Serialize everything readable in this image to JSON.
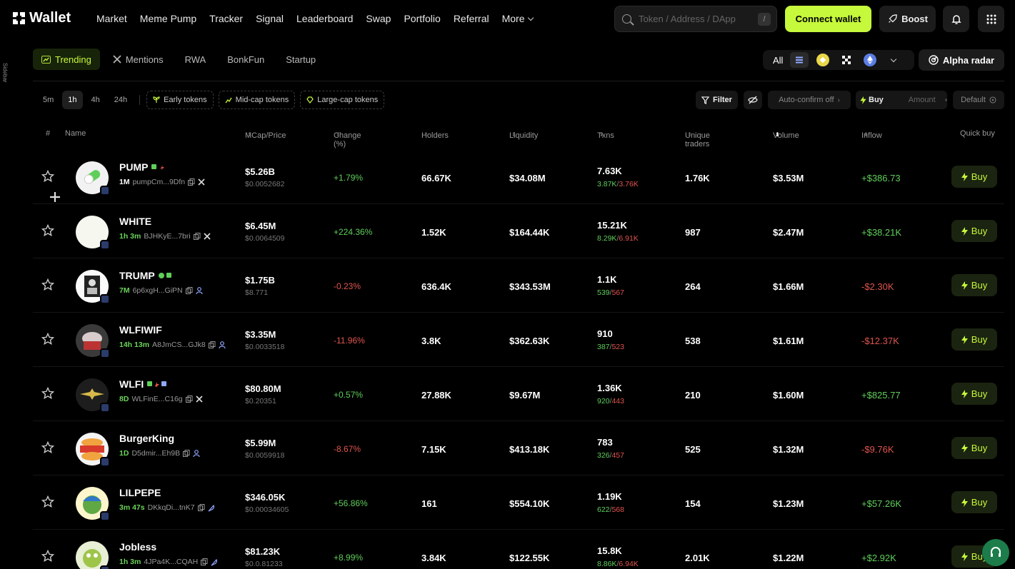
{
  "app": {
    "title": "Wallet"
  },
  "nav": {
    "items": [
      "Market",
      "Meme Pump",
      "Tracker",
      "Signal",
      "Leaderboard",
      "Swap",
      "Portfolio",
      "Referral"
    ],
    "more": "More"
  },
  "search": {
    "placeholder": "Token / Address / DApp",
    "shortcut": "/"
  },
  "header_buttons": {
    "connect": "Connect wallet",
    "boost": "Boost"
  },
  "sidebar_label": "Sidebar",
  "categories": [
    {
      "label": "Trending",
      "icon": "trending-icon",
      "active": true
    },
    {
      "label": "Mentions",
      "icon": "x-icon"
    },
    {
      "label": "RWA"
    },
    {
      "label": "BonkFun"
    },
    {
      "label": "Startup"
    }
  ],
  "chain_filter": {
    "all": "All"
  },
  "alpha_radar": "Alpha radar",
  "timeframes": [
    "5m",
    "1h",
    "4h",
    "24h"
  ],
  "active_timeframe": "1h",
  "token_chips": [
    "Early tokens",
    "Mid-cap tokens",
    "Large-cap tokens"
  ],
  "controls": {
    "filter": "Filter",
    "auto_confirm": "Auto-confirm off",
    "buy": "Buy",
    "amount": "Amount",
    "default": "Default"
  },
  "columns": {
    "index": "#",
    "name": "Name",
    "mcap": "MCap/Price",
    "change": "Change (%)",
    "holders": "Holders",
    "liquidity": "Liquidity",
    "txns": "Txns",
    "traders": "Unique traders",
    "volume": "Volume",
    "inflow": "Inflow",
    "quick": "Quick buy"
  },
  "buy_label": "Buy",
  "rows": [
    {
      "name": "PUMP",
      "age": "1M",
      "addr": "pumpCm...9Dfn",
      "mcap": "$5.26B",
      "price": "$0.0052682",
      "change": "+1.79%",
      "change_dir": "pos",
      "holders": "66.67K",
      "liquidity": "$34.08M",
      "txns": "7.63K",
      "buys": "3.87K",
      "sells": "3.76K",
      "traders": "1.76K",
      "volume": "$3.53M",
      "inflow": "+$386.73",
      "inflow_dir": "pos"
    },
    {
      "name": "WHITE",
      "age": "1h 3m",
      "addr": "BJHKyE...7bri",
      "mcap": "$6.45M",
      "price": "$0.0064509",
      "change": "+224.36%",
      "change_dir": "pos",
      "holders": "1.52K",
      "liquidity": "$164.44K",
      "txns": "15.21K",
      "buys": "8.29K",
      "sells": "6.91K",
      "traders": "987",
      "volume": "$2.47M",
      "inflow": "+$38.21K",
      "inflow_dir": "pos"
    },
    {
      "name": "TRUMP",
      "age": "7M",
      "addr": "6p6xgH...GiPN",
      "mcap": "$1.75B",
      "price": "$8.771",
      "change": "-0.23%",
      "change_dir": "neg",
      "holders": "636.4K",
      "liquidity": "$343.53M",
      "txns": "1.1K",
      "buys": "539",
      "sells": "567",
      "traders": "264",
      "volume": "$1.66M",
      "inflow": "-$2.30K",
      "inflow_dir": "neg"
    },
    {
      "name": "WLFIWIF",
      "age": "14h 13m",
      "addr": "A8JmCS...GJk8",
      "mcap": "$3.35M",
      "price": "$0.0033518",
      "change": "-11.96%",
      "change_dir": "neg",
      "holders": "3.8K",
      "liquidity": "$362.63K",
      "txns": "910",
      "buys": "387",
      "sells": "523",
      "traders": "538",
      "volume": "$1.61M",
      "inflow": "-$12.37K",
      "inflow_dir": "neg"
    },
    {
      "name": "WLFI",
      "age": "8D",
      "addr": "WLFinE...C16g",
      "mcap": "$80.80M",
      "price": "$0.20351",
      "change": "+0.57%",
      "change_dir": "pos",
      "holders": "27.88K",
      "liquidity": "$9.67M",
      "txns": "1.36K",
      "buys": "920",
      "sells": "443",
      "traders": "210",
      "volume": "$1.60M",
      "inflow": "+$825.77",
      "inflow_dir": "pos"
    },
    {
      "name": "BurgerKing",
      "age": "1D",
      "addr": "D5dmir...Eh9B",
      "mcap": "$5.99M",
      "price": "$0.0059918",
      "change": "-8.67%",
      "change_dir": "neg",
      "holders": "7.15K",
      "liquidity": "$413.18K",
      "txns": "783",
      "buys": "326",
      "sells": "457",
      "traders": "525",
      "volume": "$1.32M",
      "inflow": "-$9.76K",
      "inflow_dir": "neg"
    },
    {
      "name": "LILPEPE",
      "age": "3m 47s",
      "addr": "DKkqDi...tnK7",
      "mcap": "$346.05K",
      "price": "$0.00034605",
      "change": "+56.86%",
      "change_dir": "pos",
      "holders": "161",
      "liquidity": "$554.10K",
      "txns": "1.19K",
      "buys": "622",
      "sells": "568",
      "traders": "154",
      "volume": "$1.23M",
      "inflow": "+$57.26K",
      "inflow_dir": "pos"
    },
    {
      "name": "Jobless",
      "age": "1h 3m",
      "addr": "4JPa4K...CQAH",
      "mcap": "$81.23K",
      "price": "$0.0.81233",
      "change": "+8.99%",
      "change_dir": "pos",
      "holders": "3.84K",
      "liquidity": "$122.55K",
      "txns": "15.8K",
      "buys": "8.86K",
      "sells": "6.94K",
      "traders": "2.01K",
      "volume": "$1.22M",
      "inflow": "+$2.92K",
      "inflow_dir": "pos"
    }
  ]
}
